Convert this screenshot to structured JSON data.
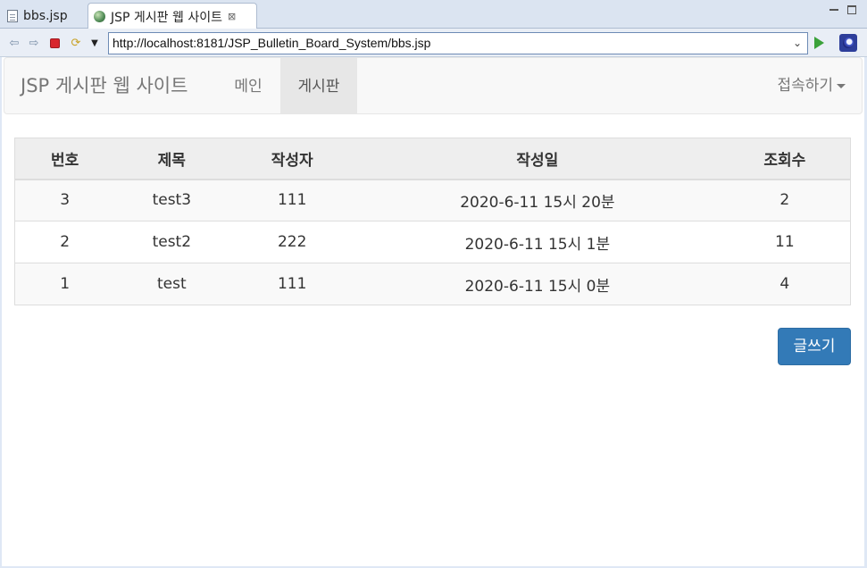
{
  "tabs": [
    {
      "label": "bbs.jsp",
      "icon": "file-icon"
    },
    {
      "label": "JSP 게시판 웹 사이트",
      "icon": "globe-icon",
      "close": "⊠"
    }
  ],
  "toolbar": {
    "url": "http://localhost:8181/JSP_Bulletin_Board_System/bbs.jsp",
    "icons": [
      "back-icon",
      "forward-icon",
      "stop-icon",
      "refresh-icon",
      "menu-dropdown-icon",
      "go-icon",
      "eclipse-icon"
    ]
  },
  "navbar": {
    "brand": "JSP 게시판 웹 사이트",
    "items": [
      {
        "label": "메인"
      },
      {
        "label": "게시판",
        "active": true
      }
    ],
    "connect": "접속하기"
  },
  "table": {
    "headers": [
      "번호",
      "제목",
      "작성자",
      "작성일",
      "조회수"
    ],
    "rows": [
      [
        "3",
        "test3",
        "111",
        "2020-6-11 15시 20분",
        "2"
      ],
      [
        "2",
        "test2",
        "222",
        "2020-6-11 15시 1분",
        "11"
      ],
      [
        "1",
        "test",
        "111",
        "2020-6-11 15시 0분",
        "4"
      ]
    ]
  },
  "write_button": "글쓰기",
  "colors": {
    "primary": "#337ab7",
    "navbar_bg": "#f8f8f8",
    "active_nav_bg": "#e7e7e7"
  }
}
